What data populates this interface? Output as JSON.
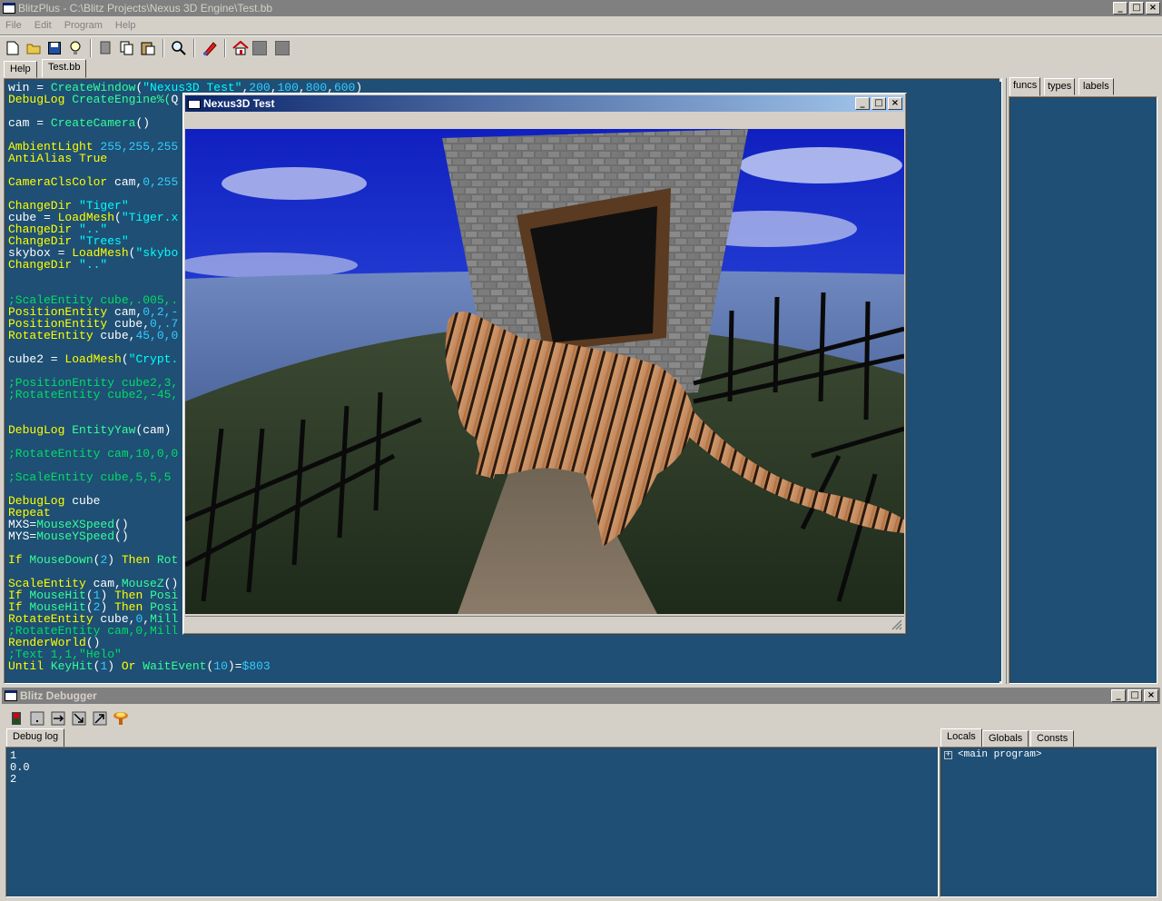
{
  "app": {
    "title": "BlitzPlus - C:\\Blitz Projects\\Nexus 3D Engine\\Test.bb",
    "menu": [
      "File",
      "Edit",
      "Program",
      "Help"
    ],
    "tabs": [
      "Help",
      "Test.bb"
    ],
    "right_tabs": [
      "funcs",
      "types",
      "labels"
    ]
  },
  "toolbar": {
    "icons": [
      "new-file-icon",
      "open-folder-icon",
      "save-icon",
      "lightbulb-icon",
      "cut-icon",
      "copy-icon",
      "paste-icon",
      "find-icon",
      "run-icon",
      "home-icon",
      "gray-square-icon",
      "gray-square-icon"
    ]
  },
  "editor": {
    "lines": [
      [
        [
          "id",
          "win = "
        ],
        [
          "fn",
          "CreateWindow"
        ],
        [
          "id",
          "("
        ],
        [
          "str",
          "\"Nexus3D Test\""
        ],
        [
          "id",
          ","
        ],
        [
          "num",
          "200"
        ],
        [
          "id",
          ","
        ],
        [
          "num",
          "100"
        ],
        [
          "id",
          ","
        ],
        [
          "num",
          "800"
        ],
        [
          "id",
          ","
        ],
        [
          "num",
          "600"
        ],
        [
          "id",
          ")"
        ]
      ],
      [
        [
          "kw",
          "DebugLog "
        ],
        [
          "fn",
          "CreateEngine%("
        ],
        [
          "id",
          "Q"
        ]
      ],
      [],
      [
        [
          "id",
          "cam = "
        ],
        [
          "fn",
          "CreateCamera"
        ],
        [
          "id",
          "()"
        ]
      ],
      [],
      [
        [
          "kw",
          "AmbientLight "
        ],
        [
          "num",
          "255,255,255"
        ]
      ],
      [
        [
          "kw",
          "AntiAlias "
        ],
        [
          "kw",
          "True"
        ]
      ],
      [],
      [
        [
          "kw",
          "CameraClsColor "
        ],
        [
          "id",
          "cam,"
        ],
        [
          "num",
          "0,255"
        ]
      ],
      [],
      [
        [
          "kw",
          "ChangeDir "
        ],
        [
          "str",
          "\"Tiger\""
        ]
      ],
      [
        [
          "id",
          "cube = "
        ],
        [
          "kw",
          "LoadMesh"
        ],
        [
          "id",
          "("
        ],
        [
          "str",
          "\"Tiger.x"
        ]
      ],
      [
        [
          "kw",
          "ChangeDir "
        ],
        [
          "str",
          "\"..\""
        ]
      ],
      [
        [
          "kw",
          "ChangeDir "
        ],
        [
          "str",
          "\"Trees\""
        ]
      ],
      [
        [
          "id",
          "skybox = "
        ],
        [
          "kw",
          "LoadMesh"
        ],
        [
          "id",
          "("
        ],
        [
          "str",
          "\"skybo"
        ]
      ],
      [
        [
          "kw",
          "ChangeDir "
        ],
        [
          "str",
          "\"..\""
        ]
      ],
      [],
      [],
      [
        [
          "cm",
          ";ScaleEntity cube,.005,."
        ]
      ],
      [
        [
          "kw",
          "PositionEntity "
        ],
        [
          "id",
          "cam,"
        ],
        [
          "num",
          "0,2,-"
        ]
      ],
      [
        [
          "kw",
          "PositionEntity "
        ],
        [
          "id",
          "cube,"
        ],
        [
          "num",
          "0,.7"
        ]
      ],
      [
        [
          "kw",
          "RotateEntity "
        ],
        [
          "id",
          "cube,"
        ],
        [
          "num",
          "45,0,0"
        ]
      ],
      [],
      [
        [
          "id",
          "cube2 = "
        ],
        [
          "kw",
          "LoadMesh"
        ],
        [
          "id",
          "("
        ],
        [
          "str",
          "\"Crypt."
        ]
      ],
      [],
      [
        [
          "cm",
          ";PositionEntity cube2,3,"
        ]
      ],
      [
        [
          "cm",
          ";RotateEntity cube2,-45,"
        ]
      ],
      [],
      [],
      [
        [
          "kw",
          "DebugLog "
        ],
        [
          "fn",
          "EntityYaw"
        ],
        [
          "id",
          "(cam)"
        ]
      ],
      [],
      [
        [
          "cm",
          ";RotateEntity cam,10,0,0"
        ]
      ],
      [],
      [
        [
          "cm",
          ";ScaleEntity cube,5,5,5"
        ]
      ],
      [],
      [
        [
          "kw",
          "DebugLog "
        ],
        [
          "id",
          "cube"
        ]
      ],
      [
        [
          "kw",
          "Repeat"
        ]
      ],
      [
        [
          "id",
          "MXS="
        ],
        [
          "fn",
          "MouseXSpeed"
        ],
        [
          "id",
          "()"
        ]
      ],
      [
        [
          "id",
          "MYS="
        ],
        [
          "fn",
          "MouseYSpeed"
        ],
        [
          "id",
          "()"
        ]
      ],
      [],
      [
        [
          "kw",
          "If "
        ],
        [
          "fn",
          "MouseDown"
        ],
        [
          "id",
          "("
        ],
        [
          "num",
          "2"
        ],
        [
          "id",
          ") "
        ],
        [
          "kw",
          "Then "
        ],
        [
          "fn",
          "Rot"
        ]
      ],
      [],
      [
        [
          "kw",
          "ScaleEntity "
        ],
        [
          "id",
          "cam,"
        ],
        [
          "fn",
          "MouseZ"
        ],
        [
          "id",
          "()"
        ]
      ],
      [
        [
          "kw",
          "If "
        ],
        [
          "fn",
          "MouseHit"
        ],
        [
          "id",
          "("
        ],
        [
          "num",
          "1"
        ],
        [
          "id",
          ") "
        ],
        [
          "kw",
          "Then "
        ],
        [
          "fn",
          "Posi"
        ]
      ],
      [
        [
          "kw",
          "If "
        ],
        [
          "fn",
          "MouseHit"
        ],
        [
          "id",
          "("
        ],
        [
          "num",
          "2"
        ],
        [
          "id",
          ") "
        ],
        [
          "kw",
          "Then "
        ],
        [
          "fn",
          "Posi"
        ]
      ],
      [
        [
          "kw",
          "RotateEntity "
        ],
        [
          "id",
          "cube,"
        ],
        [
          "num",
          "0"
        ],
        [
          "id",
          ","
        ],
        [
          "fn",
          "Mill"
        ]
      ],
      [
        [
          "cm",
          ";RotateEntity cam,0,Mill"
        ]
      ],
      [
        [
          "kw",
          "RenderWorld"
        ],
        [
          "id",
          "()"
        ]
      ],
      [
        [
          "cm",
          ";Text 1,1,\"Helo\""
        ]
      ],
      [
        [
          "kw",
          "Until "
        ],
        [
          "fn",
          "KeyHit"
        ],
        [
          "id",
          "("
        ],
        [
          "num",
          "1"
        ],
        [
          "id",
          ") "
        ],
        [
          "kw",
          "Or "
        ],
        [
          "fn",
          "WaitEvent"
        ],
        [
          "id",
          "("
        ],
        [
          "num",
          "10"
        ],
        [
          "id",
          ")="
        ],
        [
          "num",
          "$803"
        ]
      ]
    ]
  },
  "game_window": {
    "title": "Nexus3D Test"
  },
  "debugger": {
    "title": "Blitz Debugger",
    "tabs": [
      "Debug log"
    ],
    "log": [
      "1",
      "0.0",
      "2"
    ],
    "right_tabs": [
      "Locals",
      "Globals",
      "Consts"
    ],
    "tree_root": "<main program>",
    "tree_expander": "+"
  },
  "caption": {
    "min": "_",
    "max": "□",
    "close": "×"
  },
  "colors": {
    "editor_bg": "#1f4f74",
    "titlebar_active": "#0a246a",
    "keyword": "#ffff00",
    "function": "#33ff99",
    "string": "#00ffff",
    "comment": "#00dd66"
  }
}
